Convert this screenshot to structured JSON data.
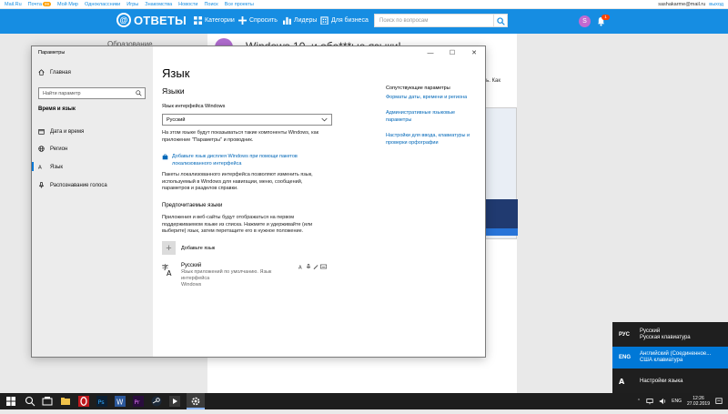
{
  "browser_top": {
    "links": [
      "Mail.Ru",
      "Почта",
      "Мой Мир",
      "Одноклассники",
      "Игры",
      "Знакомства",
      "Новости",
      "Поиск",
      "Все проекты"
    ],
    "mail_badge": "99",
    "user_email": "sashakarme@mail.ru",
    "exit_label": "выход"
  },
  "header": {
    "logo_text": "ОТВЕТЫ",
    "nav": [
      "Категории",
      "Спросить",
      "Лидеры",
      "Для бизнеса"
    ],
    "search_placeholder": "Поиск по вопросам",
    "avatar_letter": "S",
    "notif_count": "1",
    "bg_color": "#168de2"
  },
  "background_page": {
    "side_title": "Образование",
    "post_title": "Windows 10, и обе***ые языки!",
    "post_snippet": [
      "ет",
      "ы.",
      "рсть. Как"
    ]
  },
  "settings": {
    "window_title": "Параметры",
    "sidebar": {
      "home": "Главная",
      "search_placeholder": "Найти параметр",
      "section": "Время и язык",
      "items": [
        "Дата и время",
        "Регион",
        "Язык",
        "Распознавание голоса"
      ]
    },
    "main": {
      "title": "Язык",
      "subtitle": "Языки",
      "ui_lang_label": "Язык интерфейса Windows",
      "ui_lang_value": "Русский",
      "ui_lang_desc": [
        "На этом языке будут показываться такие компоненты Windows, как",
        "приложение \"Параметры\" и проводник."
      ],
      "add_display_lang": [
        "Добавьте язык дисплея Windows при помощи пакетов",
        "локализованного интерфейса"
      ],
      "lip_desc": [
        "Пакеты локализованного интерфейса позволяют изменить язык,",
        "используемый в Windows для навигации, меню, сообщений,",
        "параметров и разделов справки."
      ],
      "preferred_title": "Предпочитаемые языки",
      "preferred_desc": [
        "Приложения и веб-сайты будут отображаться на первом",
        "поддерживаемом языке из списка. Нажмите и удерживайте (или",
        "выберите) язык, затем перетащите его в нужное положение."
      ],
      "add_lang_label": "Добавьте язык",
      "lang_name": "Русский",
      "lang_desc": [
        "Язык приложений по умолчанию. Язык интерфейса",
        "Windows"
      ]
    },
    "related": {
      "title": "Сопутствующие параметры",
      "links": [
        [
          "Форматы даты, времени и региона"
        ],
        [
          "Административные языковые",
          "параметры"
        ],
        [
          "Настройки для ввода, клавиатуры и",
          "проверки орфографии"
        ]
      ]
    }
  },
  "lang_popup": {
    "rows": [
      {
        "code": "РУС",
        "name": [
          "Русский",
          "Русская клавиатура"
        ]
      },
      {
        "code": "ENG",
        "name": [
          "Английский (Соединенное...",
          "США клавиатура"
        ]
      },
      {
        "code": "",
        "name": [
          "Настройки языка"
        ]
      }
    ]
  },
  "taskbar": {
    "lang": "ENG",
    "time": "12:26",
    "date": "27.02.2019"
  }
}
